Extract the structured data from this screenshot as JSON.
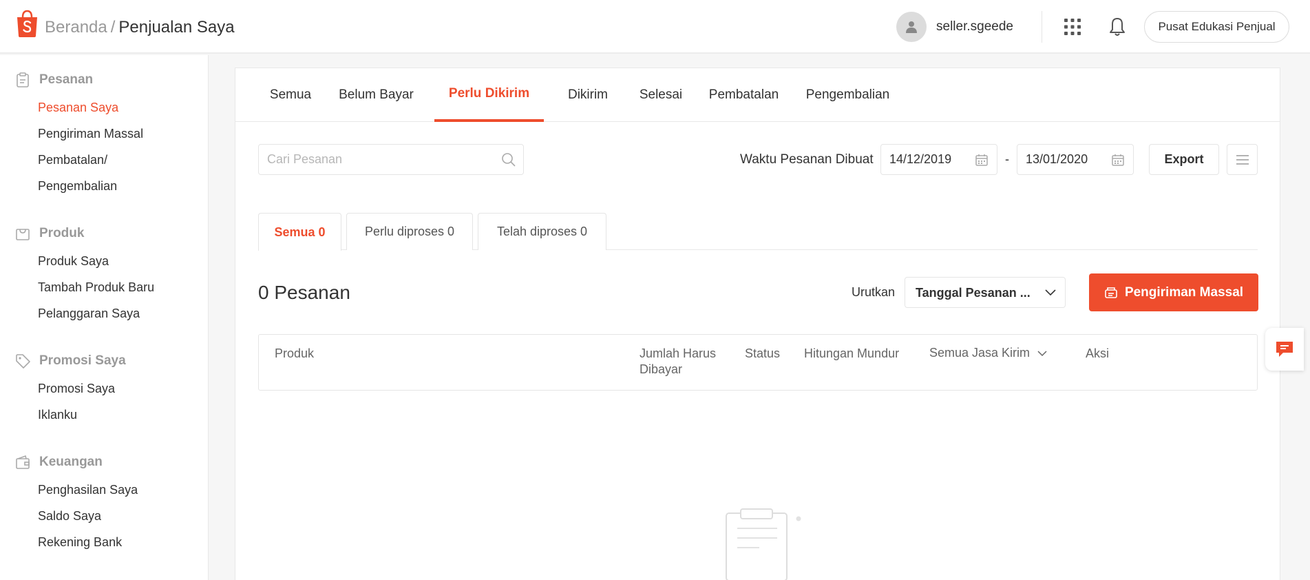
{
  "header": {
    "breadcrumb_home": "Beranda",
    "breadcrumb_sep": "/",
    "breadcrumb_current": "Penjualan Saya",
    "username": "seller.sgeede",
    "edu_button": "Pusat Edukasi Penjual"
  },
  "sidebar": {
    "sections": [
      {
        "label": "Pesanan",
        "icon": "clipboard-icon",
        "items": [
          "Pesanan Saya",
          "Pengiriman Massal",
          "Pembatalan/",
          "Pengembalian"
        ]
      },
      {
        "label": "Produk",
        "icon": "bag-icon",
        "items": [
          "Produk Saya",
          "Tambah Produk Baru",
          "Pelanggaran Saya"
        ]
      },
      {
        "label": "Promosi Saya",
        "icon": "tag-icon",
        "items": [
          "Promosi Saya",
          "Iklanku"
        ]
      },
      {
        "label": "Keuangan",
        "icon": "wallet-icon",
        "items": [
          "Penghasilan Saya",
          "Saldo Saya",
          "Rekening Bank"
        ]
      }
    ]
  },
  "tabs": [
    "Semua",
    "Belum Bayar",
    "Perlu Dikirim",
    "Dikirim",
    "Selesai",
    "Pembatalan",
    "Pengembalian"
  ],
  "active_tab": "Perlu Dikirim",
  "filters": {
    "search_placeholder": "Cari Pesanan",
    "date_label": "Waktu Pesanan Dibuat",
    "date_from": "14/12/2019",
    "date_sep": "-",
    "date_to": "13/01/2020",
    "export_label": "Export"
  },
  "subtabs": [
    "Semua 0",
    "Perlu diproses 0",
    "Telah diproses 0"
  ],
  "order_count": "0 Pesanan",
  "sort": {
    "label": "Urutkan",
    "value": "Tanggal Pesanan ..."
  },
  "mass_ship_button": "Pengiriman Massal",
  "table_headers": {
    "product": "Produk",
    "amount_line1": "Jumlah Harus",
    "amount_line2": "Dibayar",
    "status": "Status",
    "countdown": "Hitungan Mundur",
    "courier_filter": "Semua Jasa Kirim",
    "action": "Aksi"
  },
  "colors": {
    "accent": "#ee4d2d",
    "muted": "#999999",
    "border": "#e5e5e5"
  }
}
